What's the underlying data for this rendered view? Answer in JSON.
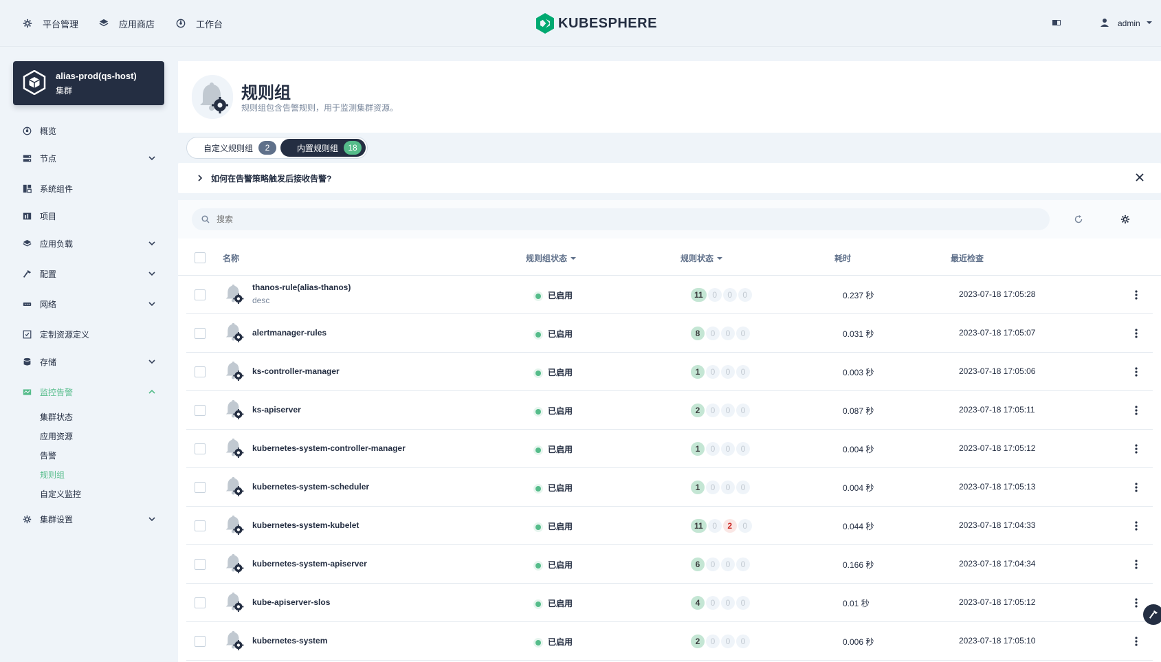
{
  "topbar": {
    "nav": [
      {
        "label": "平台管理",
        "icon": "gear-icon"
      },
      {
        "label": "应用商店",
        "icon": "layers-icon"
      },
      {
        "label": "工作台",
        "icon": "dashboard-icon"
      }
    ],
    "logo_text": "KUBESPHERE",
    "user": "admin"
  },
  "cluster": {
    "name": "alias-prod(qs-host)",
    "type": "集群"
  },
  "sidebar": {
    "items": [
      {
        "label": "概览",
        "icon": "dashboard-icon",
        "expandable": false
      },
      {
        "label": "节点",
        "icon": "server-icon",
        "expandable": true
      },
      {
        "label": "系统组件",
        "icon": "components-icon",
        "expandable": false
      },
      {
        "label": "项目",
        "icon": "project-icon",
        "expandable": false
      },
      {
        "label": "应用负载",
        "icon": "layers-icon",
        "expandable": true
      },
      {
        "label": "配置",
        "icon": "hammer-icon",
        "expandable": true
      },
      {
        "label": "网络",
        "icon": "network-icon",
        "expandable": true
      },
      {
        "label": "定制资源定义",
        "icon": "crd-icon",
        "expandable": false
      },
      {
        "label": "存储",
        "icon": "database-icon",
        "expandable": true
      },
      {
        "label": "监控告警",
        "icon": "monitor-icon",
        "expandable": true,
        "active": true
      },
      {
        "label": "集群设置",
        "icon": "gear-icon",
        "expandable": true
      }
    ],
    "subitems": [
      "集群状态",
      "应用资源",
      "告警",
      "规则组",
      "自定义监控"
    ],
    "active_subitem": "规则组"
  },
  "header": {
    "title": "规则组",
    "description": "规则组包含告警规则，用于监测集群资源。"
  },
  "tabs": [
    {
      "label": "自定义规则组",
      "count": "2"
    },
    {
      "label": "内置规则组",
      "count": "18",
      "active": true
    }
  ],
  "tip": {
    "text": "如何在告警策略触发后接收告警?"
  },
  "search": {
    "placeholder": "搜索"
  },
  "table": {
    "columns": {
      "name": "名称",
      "group_status": "规则组状态",
      "rule_status": "规则状态",
      "duration": "耗时",
      "last_check": "最近检查"
    },
    "rows": [
      {
        "name": "thanos-rule(alias-thanos)",
        "desc": "desc",
        "status": "已启用",
        "counts": [
          "11",
          "0",
          "0",
          "0"
        ],
        "duration": "0.237 秒",
        "last_check": "2023-07-18 17:05:28"
      },
      {
        "name": "alertmanager-rules",
        "desc": "",
        "status": "已启用",
        "counts": [
          "8",
          "0",
          "0",
          "0"
        ],
        "duration": "0.031 秒",
        "last_check": "2023-07-18 17:05:07"
      },
      {
        "name": "ks-controller-manager",
        "desc": "",
        "status": "已启用",
        "counts": [
          "1",
          "0",
          "0",
          "0"
        ],
        "duration": "0.003 秒",
        "last_check": "2023-07-18 17:05:06"
      },
      {
        "name": "ks-apiserver",
        "desc": "",
        "status": "已启用",
        "counts": [
          "2",
          "0",
          "0",
          "0"
        ],
        "duration": "0.087 秒",
        "last_check": "2023-07-18 17:05:11"
      },
      {
        "name": "kubernetes-system-controller-manager",
        "desc": "",
        "status": "已启用",
        "counts": [
          "1",
          "0",
          "0",
          "0"
        ],
        "duration": "0.004 秒",
        "last_check": "2023-07-18 17:05:12"
      },
      {
        "name": "kubernetes-system-scheduler",
        "desc": "",
        "status": "已启用",
        "counts": [
          "1",
          "0",
          "0",
          "0"
        ],
        "duration": "0.004 秒",
        "last_check": "2023-07-18 17:05:13"
      },
      {
        "name": "kubernetes-system-kubelet",
        "desc": "",
        "status": "已启用",
        "counts": [
          "11",
          "0",
          "2",
          "0"
        ],
        "duration": "0.044 秒",
        "last_check": "2023-07-18 17:04:33"
      },
      {
        "name": "kubernetes-system-apiserver",
        "desc": "",
        "status": "已启用",
        "counts": [
          "6",
          "0",
          "0",
          "0"
        ],
        "duration": "0.166 秒",
        "last_check": "2023-07-18 17:04:34"
      },
      {
        "name": "kube-apiserver-slos",
        "desc": "",
        "status": "已启用",
        "counts": [
          "4",
          "0",
          "0",
          "0"
        ],
        "duration": "0.01 秒",
        "last_check": "2023-07-18 17:05:12"
      },
      {
        "name": "kubernetes-system",
        "desc": "",
        "status": "已启用",
        "counts": [
          "2",
          "0",
          "0",
          "0"
        ],
        "duration": "0.006 秒",
        "last_check": "2023-07-18 17:05:10"
      }
    ]
  },
  "colors": {
    "accent": "#55bc8a",
    "dark": "#242e42",
    "warn": "#ca2621"
  }
}
